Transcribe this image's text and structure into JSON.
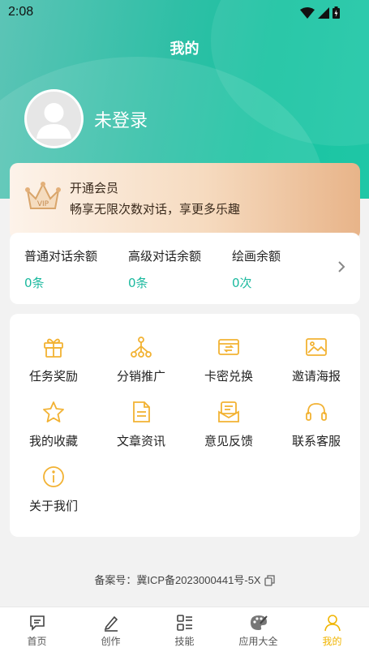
{
  "status": {
    "time": "2:08"
  },
  "header": {
    "title": "我的"
  },
  "profile": {
    "login_text": "未登录"
  },
  "vip": {
    "title": "开通会员",
    "subtitle": "畅享无限次数对话，享更多乐趣",
    "crown_text": "VIP"
  },
  "balances": [
    {
      "label": "普通对话余额",
      "value": "0条"
    },
    {
      "label": "高级对话余额",
      "value": "0条"
    },
    {
      "label": "绘画余额",
      "value": "0次"
    }
  ],
  "menu": [
    {
      "label": "任务奖励",
      "icon": "gift-icon"
    },
    {
      "label": "分销推广",
      "icon": "share-tree-icon"
    },
    {
      "label": "卡密兑换",
      "icon": "card-exchange-icon"
    },
    {
      "label": "邀请海报",
      "icon": "image-icon"
    },
    {
      "label": "我的收藏",
      "icon": "star-icon"
    },
    {
      "label": "文章资讯",
      "icon": "document-icon"
    },
    {
      "label": "意见反馈",
      "icon": "feedback-icon"
    },
    {
      "label": "联系客服",
      "icon": "headset-icon"
    },
    {
      "label": "关于我们",
      "icon": "info-icon"
    }
  ],
  "footer": {
    "icp": "备案号：冀ICP备2023000441号-5X"
  },
  "tabs": [
    {
      "label": "首页",
      "icon": "chat-icon"
    },
    {
      "label": "创作",
      "icon": "edit-icon"
    },
    {
      "label": "技能",
      "icon": "apps-list-icon"
    },
    {
      "label": "应用大全",
      "icon": "palette-icon"
    },
    {
      "label": "我的",
      "icon": "user-icon",
      "active": true
    }
  ],
  "colors": {
    "accent": "#1bb99e",
    "tab_active": "#f0b400",
    "menu_icon": "#f2b233"
  }
}
